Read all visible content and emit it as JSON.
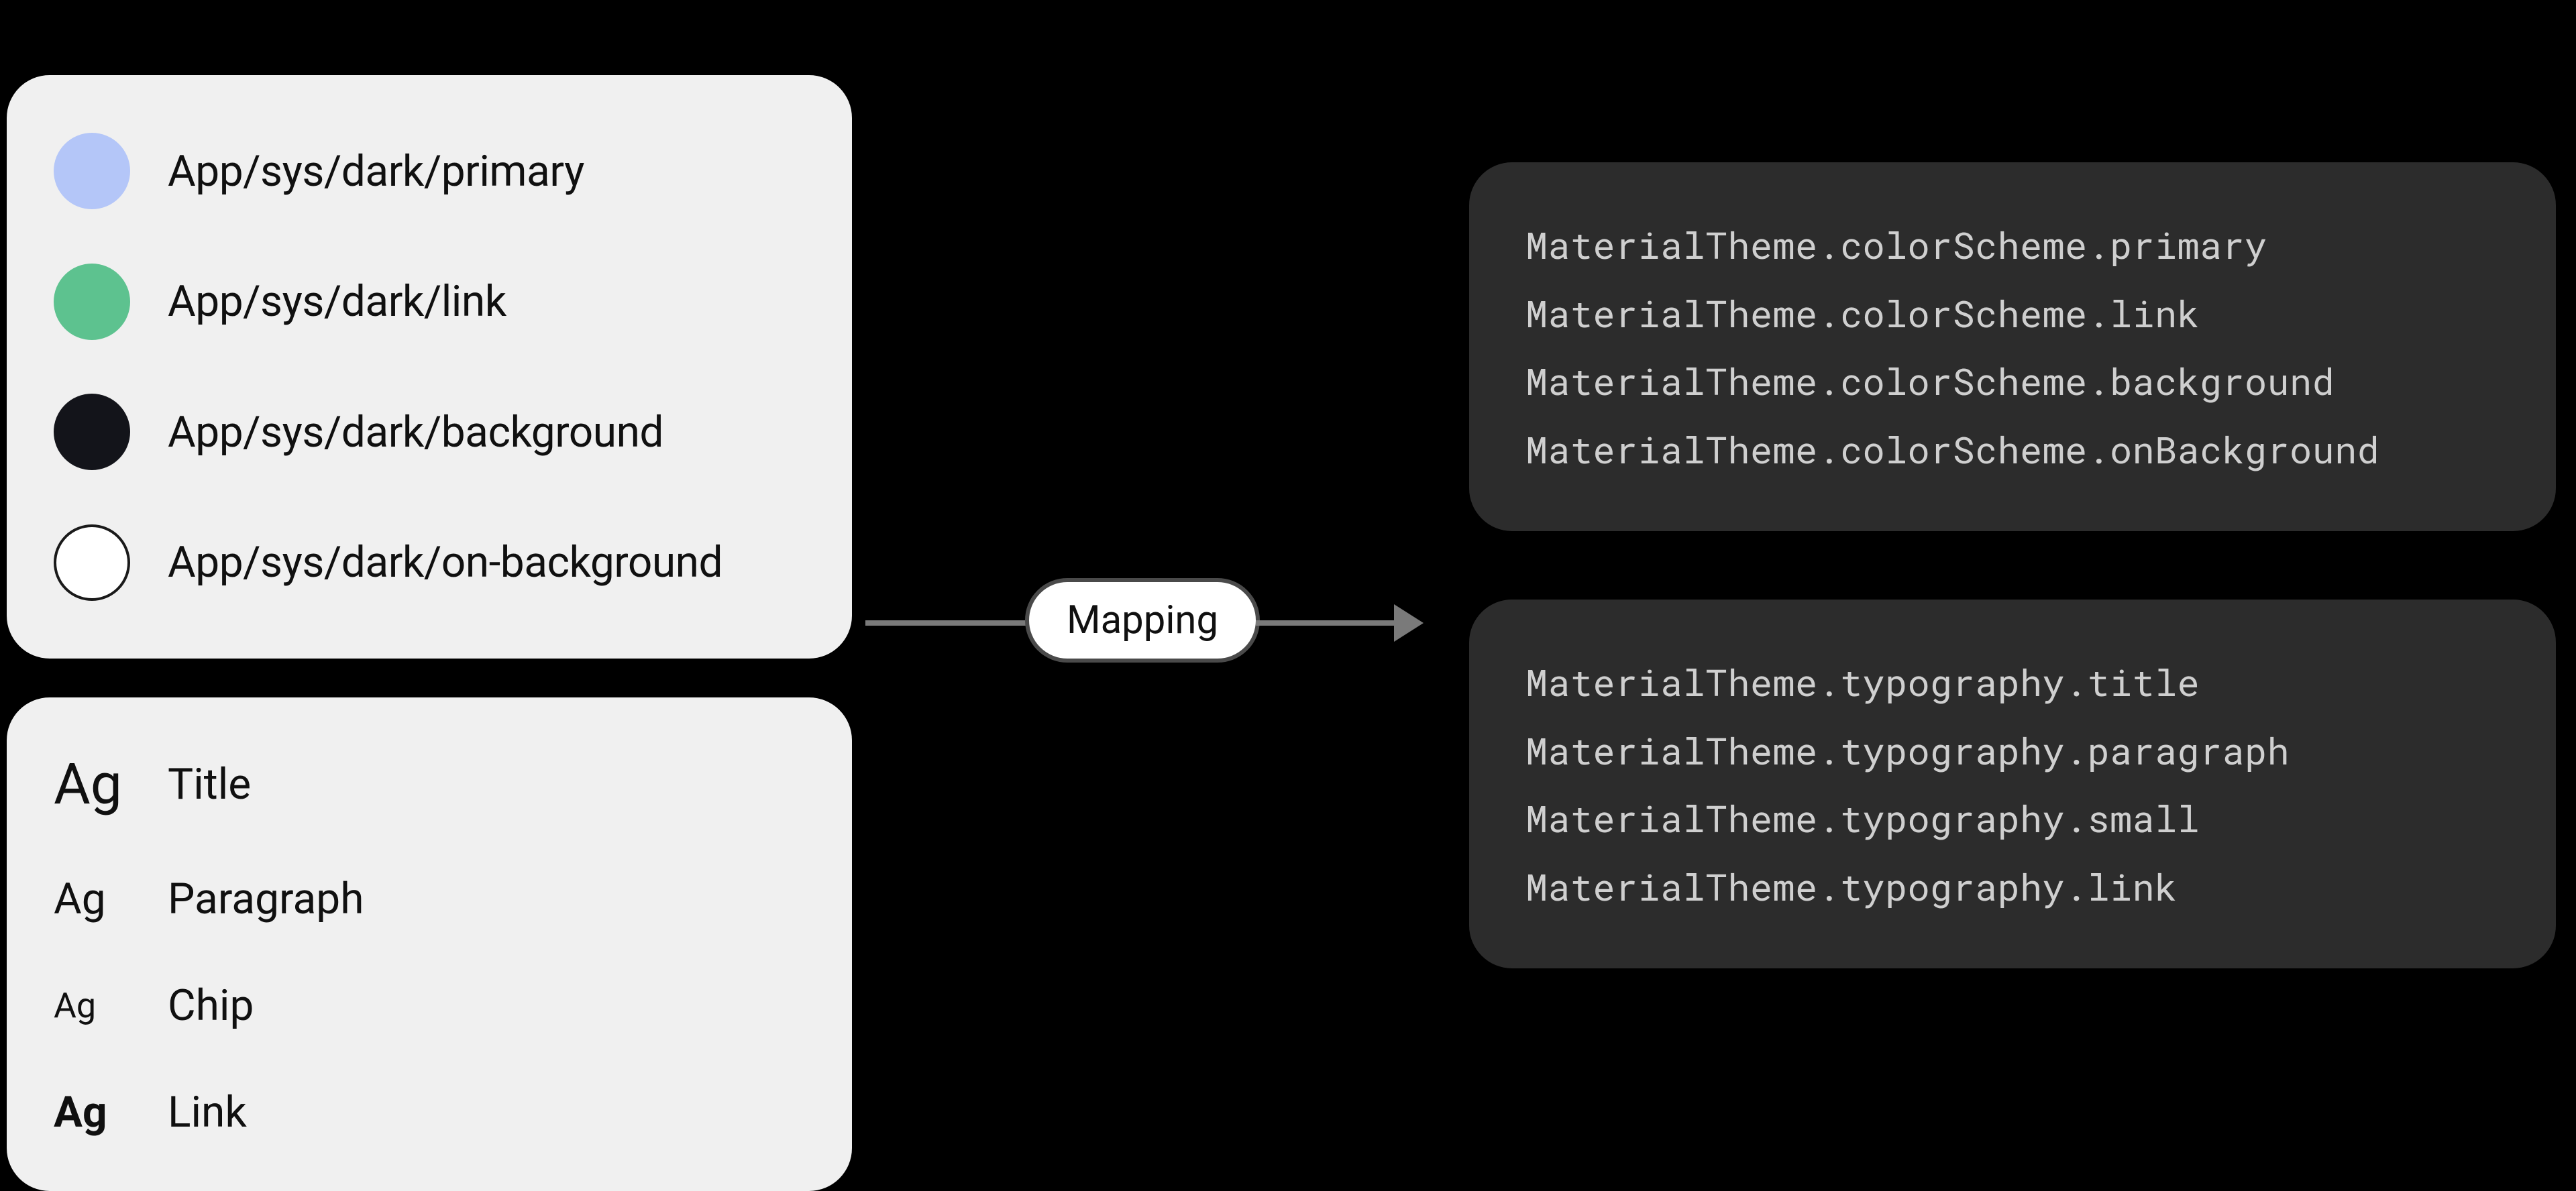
{
  "colors": {
    "primary": {
      "label": "App/sys/dark/primary",
      "swatch_fill": "#b4c6f8",
      "swatch_border": "transparent"
    },
    "link": {
      "label": "App/sys/dark/link",
      "swatch_fill": "#5dc28f",
      "swatch_border": "transparent"
    },
    "background": {
      "label": "App/sys/dark/background",
      "swatch_fill": "#13141a",
      "swatch_border": "transparent"
    },
    "onbg": {
      "label": "App/sys/dark/on-background",
      "swatch_fill": "#ffffff",
      "swatch_border": "#1a1a1a"
    }
  },
  "typography": {
    "sample_glyph": "Ag",
    "title": {
      "label": "Title"
    },
    "paragraph": {
      "label": "Paragraph"
    },
    "chip": {
      "label": "Chip"
    },
    "link": {
      "label": "Link"
    }
  },
  "mapping": {
    "label": "Mapping"
  },
  "code_colors": {
    "l0": "MaterialTheme.colorScheme.primary",
    "l1": "MaterialTheme.colorScheme.link",
    "l2": "MaterialTheme.colorScheme.background",
    "l3": "MaterialTheme.colorScheme.onBackground"
  },
  "code_typo": {
    "l0": "MaterialTheme.typography.title",
    "l1": "MaterialTheme.typography.paragraph",
    "l2": "MaterialTheme.typography.small",
    "l3": "MaterialTheme.typography.link"
  }
}
